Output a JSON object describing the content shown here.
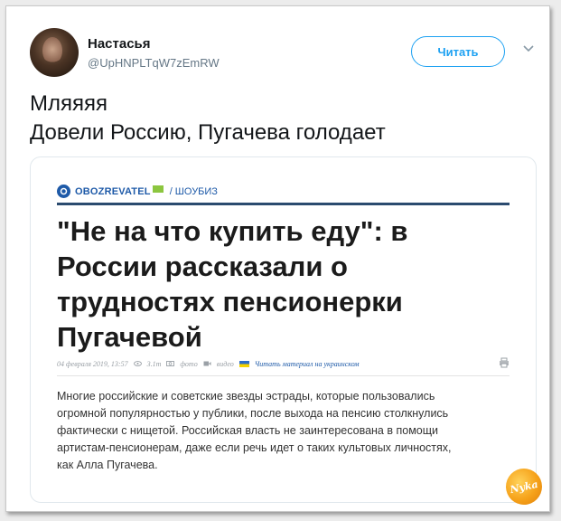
{
  "tweet": {
    "author_name": "Настасья",
    "author_handle": "@UpHNPLTqW7zEmRW",
    "follow_label": "Читать",
    "text_lines": [
      "Мляяяя",
      "Довели Россию, Пугачева голодает"
    ]
  },
  "card": {
    "source_logo": "OBOZREVATEL",
    "section": "/ ШОУБИЗ",
    "headline_lines": [
      "\"Не на что купить еду\": в",
      "России рассказали о",
      "трудностях пенсионерки",
      "Пугачевой"
    ],
    "meta": {
      "date": "04 февраля 2019, 13:57",
      "views": "3.1т",
      "photo": "фото",
      "video": "видео",
      "translate_link": "Читать материал на украинском"
    },
    "body_lines": [
      "Многие российские и советские звезды эстрады, которые пользовались",
      "огромной популярностью у публики, после выхода на пенсию столкнулись",
      "фактически с нищетой. Российская власть не заинтересована в помощи",
      "артистам-пенсионерам, даже если речь идет о таких культовых личностях,",
      "как Алла Пугачева."
    ]
  },
  "watermark": "Nyka",
  "colors": {
    "accent": "#1da1f2",
    "brand": "#1e5aa8",
    "rule": "#2b4b6f"
  }
}
